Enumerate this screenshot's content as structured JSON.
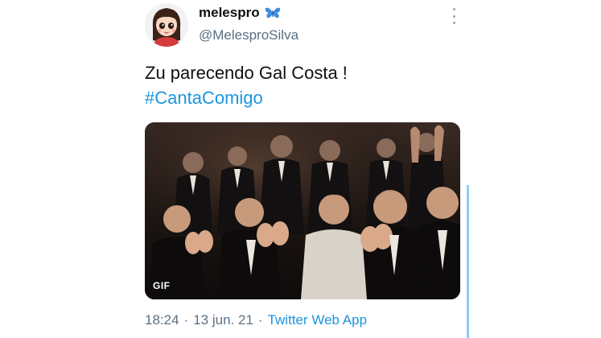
{
  "author": {
    "display_name": "melespro",
    "handle": "@MelesproSilva",
    "badge_icon": "butterfly-icon",
    "avatar_icon": "cartoon-girl-avatar"
  },
  "tweet": {
    "text": "Zu parecendo Gal Costa !",
    "hashtag": "#CantaComigo"
  },
  "media": {
    "type": "gif",
    "badge": "GIF",
    "description_icon": "audience-applauding-image"
  },
  "meta": {
    "time": "18:24",
    "separator": "·",
    "date": "13 jun. 21",
    "source": "Twitter Web App"
  },
  "colors": {
    "link": "#1b95e0",
    "secondary_text": "#5b7083",
    "thread_line": "#8ecdf3"
  }
}
